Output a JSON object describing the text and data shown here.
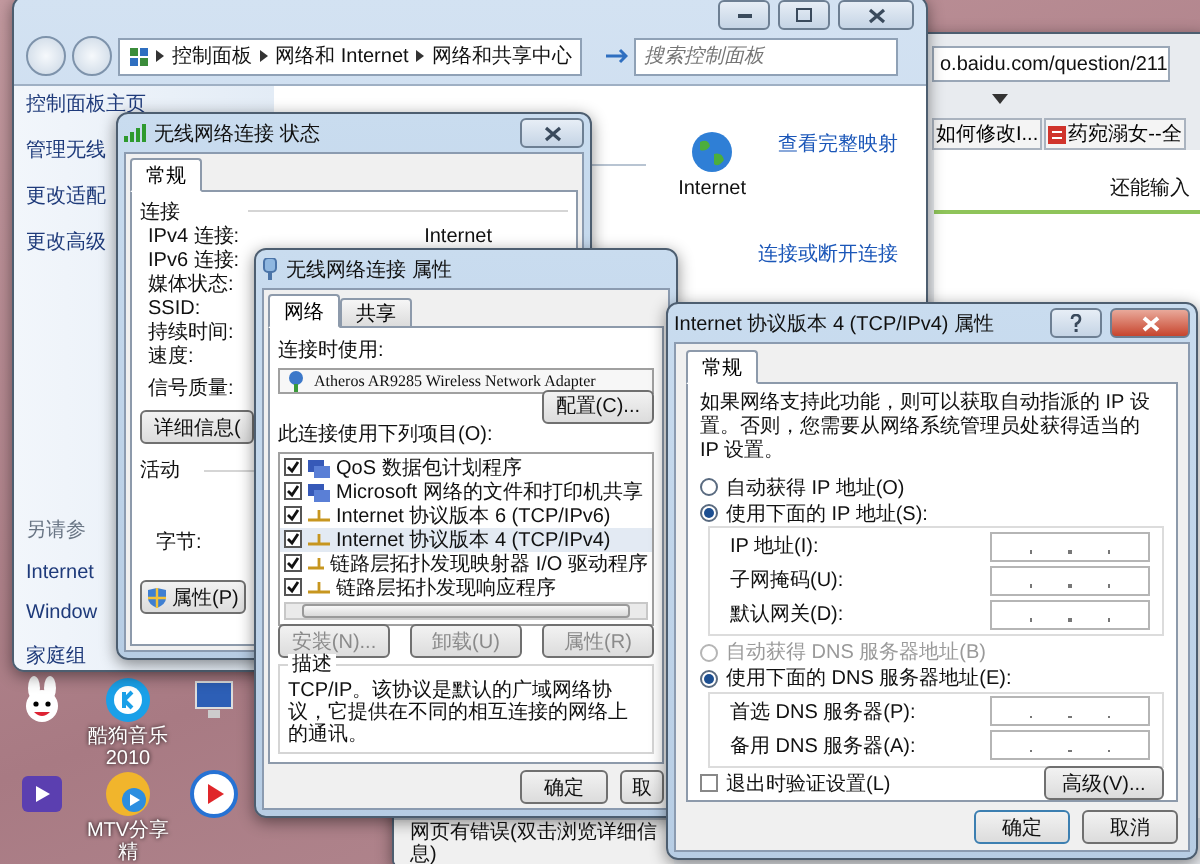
{
  "browser": {
    "address": "o.baidu.com/question/211",
    "tabs": [
      {
        "label": "如何修改I...",
        "kind": "plain"
      },
      {
        "label": "药宛溺女--全",
        "kind": "icon"
      }
    ],
    "counter_label": "还能输入",
    "status": "网页有错误(双击浏览详细信息)"
  },
  "control_panel": {
    "breadcrumb": [
      "控制面板",
      "网络和 Internet",
      "网络和共享中心"
    ],
    "search": {
      "placeholder": "搜索控制面板"
    },
    "sidebar": {
      "items": [
        "控制面板主页",
        "管理无线",
        "更改适配",
        "更改高级"
      ],
      "see_also": {
        "heading": "另请参",
        "items": [
          "Internet",
          "Window",
          "家庭组"
        ]
      }
    },
    "network_map": {
      "node_label": "Internet",
      "view_link": "查看完整映射",
      "connect_link": "连接或断开连接"
    }
  },
  "status_window": {
    "title": "无线网络连接 状态",
    "tabs": [
      {
        "label": "常规",
        "selected": true
      }
    ],
    "connection": {
      "heading": "连接",
      "rows": [
        {
          "label": "IPv4 连接:",
          "value": "Internet"
        },
        {
          "label": "IPv6 连接:"
        },
        {
          "label": "媒体状态:"
        },
        {
          "label": "SSID:"
        },
        {
          "label": "持续时间:"
        },
        {
          "label": "速度:"
        }
      ],
      "signal_label": "信号质量:",
      "details_button": "详细信息("
    },
    "activity": {
      "heading": "活动",
      "bytes_label": "字节:"
    },
    "properties_button": "属性(P)"
  },
  "properties_window": {
    "title": "无线网络连接 属性",
    "tabs": [
      {
        "label": "网络",
        "selected": true
      },
      {
        "label": "共享",
        "selected": false
      }
    ],
    "connect_using_label": "连接时使用:",
    "adapter": "Atheros AR9285 Wireless Network Adapter",
    "configure_button": "配置(C)...",
    "items_label": "此连接使用下列项目(O):",
    "items": [
      {
        "label": "QoS 数据包计划程序",
        "kind": "service",
        "checked": true,
        "selected": false
      },
      {
        "label": "Microsoft 网络的文件和打印机共享",
        "kind": "service",
        "checked": true,
        "selected": false
      },
      {
        "label": "Internet 协议版本 6 (TCP/IPv6)",
        "kind": "protocol",
        "checked": true,
        "selected": false
      },
      {
        "label": "Internet 协议版本 4 (TCP/IPv4)",
        "kind": "protocol",
        "checked": true,
        "selected": true
      },
      {
        "label": "链路层拓扑发现映射器 I/O 驱动程序",
        "kind": "protocol",
        "checked": true,
        "selected": false
      },
      {
        "label": "链路层拓扑发现响应程序",
        "kind": "protocol",
        "checked": true,
        "selected": false
      }
    ],
    "buttons": [
      {
        "label": "安装(N)...",
        "disabled": true
      },
      {
        "label": "卸载(U)",
        "disabled": true
      },
      {
        "label": "属性(R)",
        "disabled": true
      }
    ],
    "description": {
      "heading": "描述",
      "text": "TCP/IP。该协议是默认的广域网络协议，它提供在不同的相互连接的网络上的通讯。"
    },
    "ok_button": "确定",
    "cancel_button": "取"
  },
  "tcp_window": {
    "title": "Internet 协议版本 4 (TCP/IPv4) 属性",
    "tabs": [
      {
        "label": "常规",
        "selected": true
      }
    ],
    "intro": "如果网络支持此功能，则可以获取自动指派的 IP 设置。否则，您需要从网络系统管理员处获得适当的 IP 设置。",
    "ip_options": [
      {
        "label": "自动获得 IP 地址(O)",
        "selected": false,
        "disabled": false
      },
      {
        "label": "使用下面的 IP 地址(S):",
        "selected": true,
        "disabled": false
      }
    ],
    "ip_fields": [
      {
        "label": "IP 地址(I):"
      },
      {
        "label": "子网掩码(U):"
      },
      {
        "label": "默认网关(D):"
      }
    ],
    "dns_options": [
      {
        "label": "自动获得 DNS 服务器地址(B)",
        "selected": false,
        "disabled": true
      },
      {
        "label": "使用下面的 DNS 服务器地址(E):",
        "selected": true,
        "disabled": false
      }
    ],
    "dns_fields": [
      {
        "label": "首选 DNS 服务器(P):"
      },
      {
        "label": "备用 DNS 服务器(A):"
      }
    ],
    "validate": {
      "label": "退出时验证设置(L)",
      "checked": false
    },
    "advanced_button": "高级(V)...",
    "ok_button": "确定",
    "cancel_button": "取消"
  },
  "desktop_icons": [
    {
      "kind": "rabbit"
    },
    {
      "kind": "music",
      "label": "酷狗音乐 2010"
    },
    {
      "kind": "computer"
    },
    {
      "kind": "video"
    },
    {
      "kind": "disc",
      "label": "MTV分享精"
    },
    {
      "kind": "play"
    }
  ]
}
